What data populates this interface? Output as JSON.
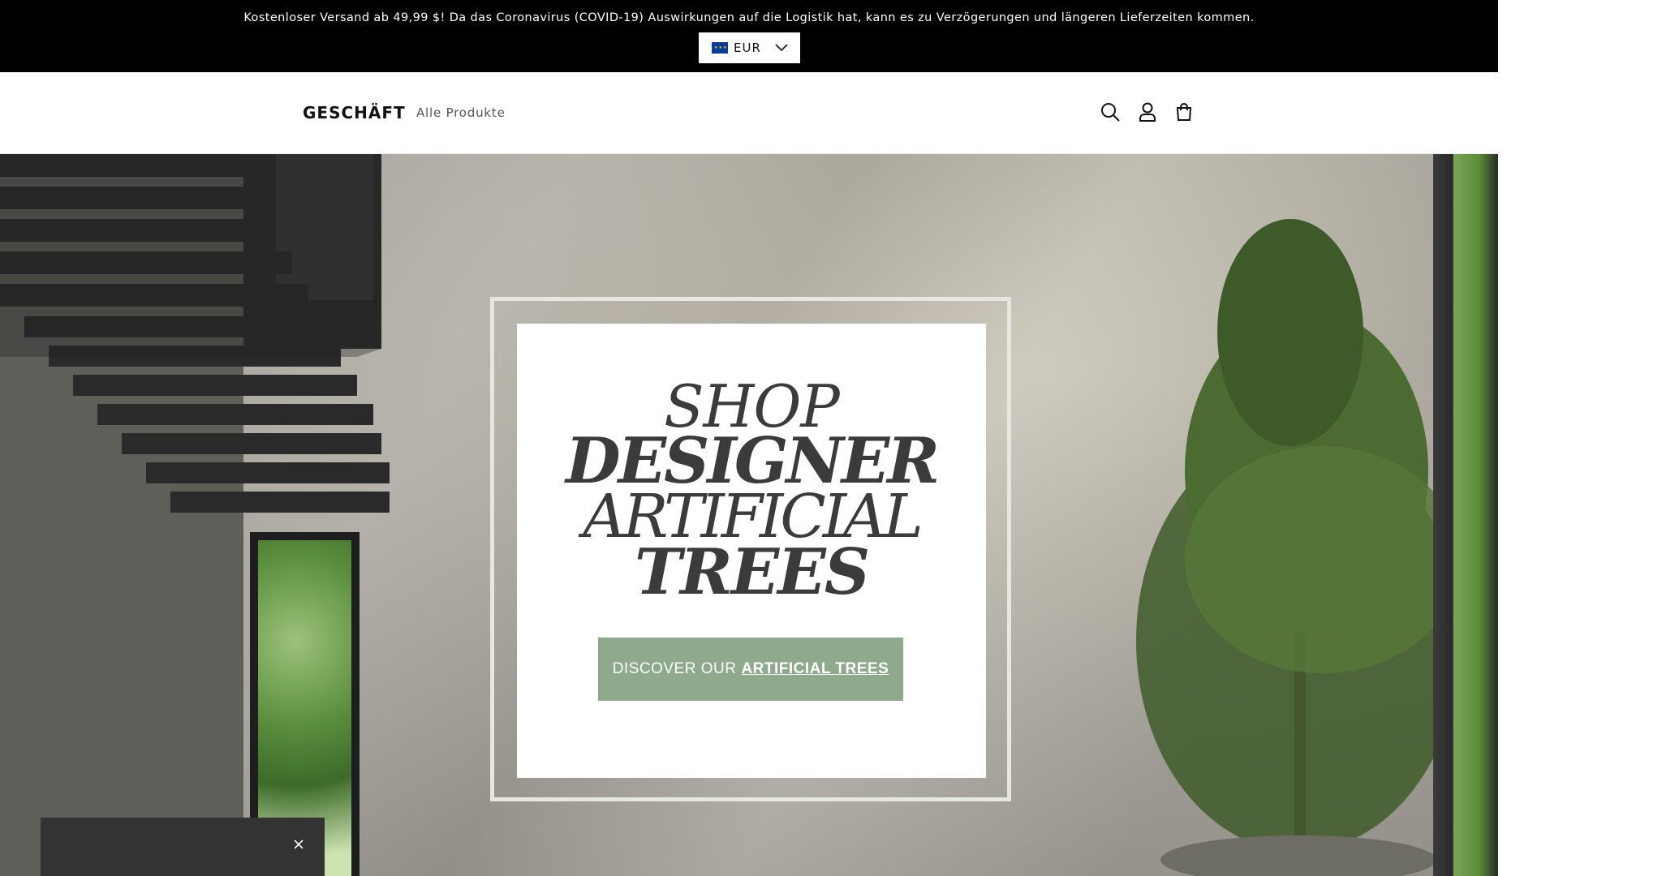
{
  "announcement": {
    "text": "Kostenloser Versand ab 49,99 $! Da das Coronavirus (COVID-19) Auswirkungen auf die Logistik hat, kann es zu Verzögerungen und längeren Lieferzeiten kommen."
  },
  "currency": {
    "code": "EUR",
    "icon": "eu-flag-icon"
  },
  "header": {
    "logo": "GESCHÄFT",
    "nav": [
      {
        "label": "Alle Produkte"
      }
    ],
    "icons": [
      "search-icon",
      "account-icon",
      "cart-icon"
    ]
  },
  "hero": {
    "title_lines": [
      "SHOP",
      "DESIGNER",
      "ARTIFICIAL",
      "TREES"
    ],
    "cta_prefix": "DISCOVER OUR",
    "cta_strong": "ARTIFICIAL TREES"
  },
  "colors": {
    "announcement_bg": "#000000",
    "cta_bg": "#8fa98c",
    "popup_bg": "#333333"
  }
}
